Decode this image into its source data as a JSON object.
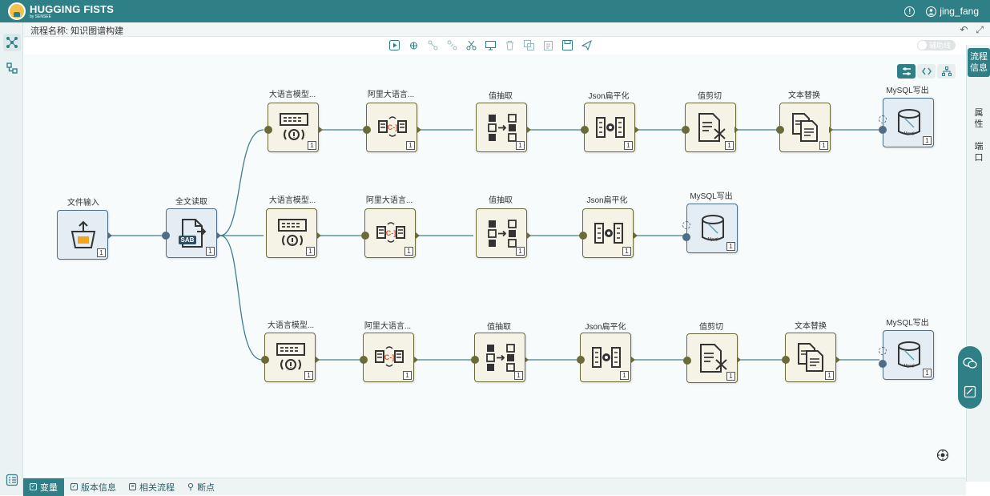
{
  "app": {
    "logo_title": "HUGGING FISTS",
    "logo_subtitle": "by SENSEE",
    "username": "jing_fang"
  },
  "flow": {
    "title": "流程名称: 知识图谱构建"
  },
  "toolbar": {
    "tools": [
      "run-icon",
      "debug-icon",
      "link-icon",
      "unlink-icon",
      "cut-icon",
      "preview-icon",
      "delete-icon",
      "copy-icon",
      "paste-icon",
      "save-icon",
      "publish-icon"
    ],
    "guide_toggle_label": "辅助线"
  },
  "right_panel": {
    "tabs": [
      "流程信息",
      "属性",
      "端口"
    ]
  },
  "bottom_tabs": [
    "变量",
    "版本信息",
    "相关流程",
    "断点"
  ],
  "nodes": {
    "file_input": {
      "label": "文件输入",
      "count": "1"
    },
    "full_text_read": {
      "label": "全文读取",
      "count": "1"
    },
    "r1": [
      {
        "label": "大语言模型...",
        "count": "1"
      },
      {
        "label": "阿里大语言...",
        "count": "1"
      },
      {
        "label": "值抽取",
        "count": "1"
      },
      {
        "label": "Json扁平化",
        "count": "1"
      },
      {
        "label": "值剪切",
        "count": "1"
      },
      {
        "label": "文本替换",
        "count": "1"
      },
      {
        "label": "MySQL写出",
        "count": "1"
      }
    ],
    "r2": [
      {
        "label": "大语言模型...",
        "count": "1"
      },
      {
        "label": "阿里大语言...",
        "count": "1"
      },
      {
        "label": "值抽取",
        "count": "1"
      },
      {
        "label": "Json扁平化",
        "count": "1"
      },
      {
        "label": "MySQL写出",
        "count": "1"
      }
    ],
    "r3": [
      {
        "label": "大语言模型...",
        "count": "1"
      },
      {
        "label": "阿里大语言...",
        "count": "1"
      },
      {
        "label": "值抽取",
        "count": "1"
      },
      {
        "label": "Json扁平化",
        "count": "1"
      },
      {
        "label": "值剪切",
        "count": "1"
      },
      {
        "label": "文本替换",
        "count": "1"
      },
      {
        "label": "MySQL写出",
        "count": "1"
      }
    ]
  },
  "glyph_text": {
    "sab": "SAB",
    "mysql": "Mysql"
  },
  "colors": {
    "brand": "#2f7f86",
    "node_border": "#6b6b3a",
    "io_border": "#4f6d86"
  }
}
